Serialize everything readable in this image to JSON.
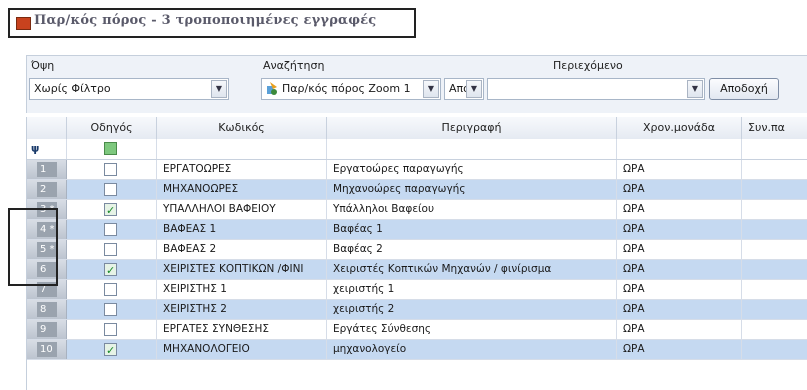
{
  "window": {
    "title": "Παρ/κός πόρος - 3 τροποποιημένες εγγραφές"
  },
  "filters": {
    "view_label": "Όψη",
    "view_value": "Χωρίς Φίλτρο",
    "search_label": "Αναζήτηση",
    "search_field_value": "Παρ/κός πόρος Zoom 1",
    "search_mode_value": "Από",
    "content_label": "Περιεχόμενο",
    "content_value": "",
    "accept_button": "Αποδοχή"
  },
  "grid": {
    "columns": [
      "Οδηγός",
      "Κωδικός",
      "Περιγραφή",
      "Χρον.μονάδα",
      "Συν.πα"
    ],
    "filter_icon": "funnel-icon",
    "rows": [
      {
        "num": "1",
        "checked": false,
        "code": "ΕΡΓΑΤΟΩΡΕΣ",
        "desc": "Εργατοώρες παραγωγής",
        "unit": "ΩΡΑ",
        "alt": false
      },
      {
        "num": "2",
        "checked": false,
        "code": "ΜΗΧΑΝΟΩΡΕΣ",
        "desc": "Μηχανοώρες παραγωγής",
        "unit": "ΩΡΑ",
        "alt": true
      },
      {
        "num": "3 *",
        "checked": true,
        "code": "ΥΠΑΛΛΗΛΟΙ ΒΑΦΕΙΟΥ",
        "desc": "Υπάλληλοι Βαφείου",
        "unit": "ΩΡΑ",
        "alt": false
      },
      {
        "num": "4 *",
        "checked": false,
        "code": "ΒΑΦΕΑΣ 1",
        "desc": "Βαφέας 1",
        "unit": "ΩΡΑ",
        "alt": true
      },
      {
        "num": "5 *",
        "checked": false,
        "code": "ΒΑΦΕΑΣ 2",
        "desc": "Βαφέας 2",
        "unit": "ΩΡΑ",
        "alt": false
      },
      {
        "num": "6",
        "checked": true,
        "code": "ΧΕΙΡΙΣΤΕΣ ΚΟΠΤΙΚΩΝ /ΦΙΝΙ",
        "desc": "Χειριστές Κοπτικών Μηχανών / φινίρισμα",
        "unit": "ΩΡΑ",
        "alt": true
      },
      {
        "num": "7",
        "checked": false,
        "code": "ΧΕΙΡΙΣΤΗΣ 1",
        "desc": "χειριστής 1",
        "unit": "ΩΡΑ",
        "alt": false
      },
      {
        "num": "8",
        "checked": false,
        "code": "ΧΕΙΡΙΣΤΗΣ 2",
        "desc": "χειριστής 2",
        "unit": "ΩΡΑ",
        "alt": true
      },
      {
        "num": "9",
        "checked": false,
        "code": "ΕΡΓΑΤΕΣ ΣΥΝΘΕΣΗΣ",
        "desc": "Εργάτες Σύνθεσης",
        "unit": "ΩΡΑ",
        "alt": false
      },
      {
        "num": "10",
        "checked": true,
        "code": "ΜΗΧΑΝΟΛΟΓΕΙΟ",
        "desc": "μηχανολογείο",
        "unit": "ΩΡΑ",
        "alt": true
      }
    ]
  },
  "colors": {
    "row_alt": "#c5d9f1",
    "title_icon": "#c8421e"
  }
}
